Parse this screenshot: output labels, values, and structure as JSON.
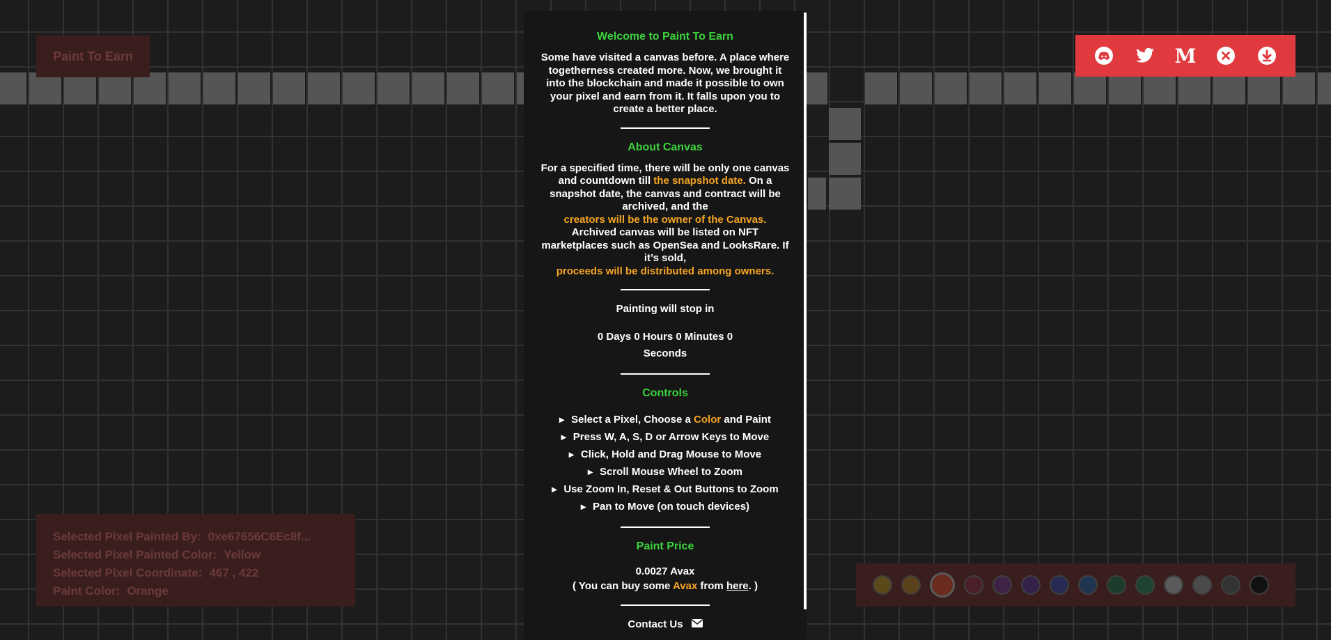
{
  "brand": {
    "title": "Paint To Earn"
  },
  "socials": [
    {
      "name": "discord-icon"
    },
    {
      "name": "twitter-icon"
    },
    {
      "name": "medium-icon",
      "glyph": "M"
    },
    {
      "name": "close-icon"
    },
    {
      "name": "download-icon"
    }
  ],
  "modal": {
    "welcome_title": "Welcome to Paint To Earn",
    "welcome_text": "Some have visited a canvas before. A place where togetherness created more. Now, we brought it into the blockchain and made it possible to own your pixel and earn from it. It falls upon you to create a better place.",
    "about_title": "About Canvas",
    "about_text_1": "For a specified time, there will be only one canvas and countdown till ",
    "about_hl_1": "the snapshot date.",
    "about_text_2": "On a snapshot date, the canvas and contract will be archived, and the",
    "about_hl_2": "creators will be the owner of the Canvas.",
    "about_text_3": "Archived canvas will be listed on NFT marketplaces such as OpenSea and LooksRare. If it’s sold,",
    "about_hl_3": "proceeds will be distributed among owners.",
    "countdown_label": "Painting will stop in",
    "countdown_value": "0 Days 0 Hours 0 Minutes 0 Seconds",
    "controls_title": "Controls",
    "controls": {
      "c1_a": "Select a Pixel, Choose a ",
      "c1_hl": "Color",
      "c1_b": " and Paint",
      "c2": "Press W, A, S, D or Arrow Keys to Move",
      "c3": "Click, Hold and Drag Mouse to Move",
      "c4": "Scroll Mouse Wheel to Zoom",
      "c5": "Use Zoom In, Reset & Out Buttons to Zoom",
      "c6": "Pan to Move (on touch devices)"
    },
    "price_title": "Paint Price",
    "price_value": "0.0027 Avax",
    "buy_a": "( You can buy some ",
    "buy_hl": "Avax",
    "buy_b": " from ",
    "buy_link": "here",
    "buy_c": ". )",
    "contact": "Contact Us"
  },
  "info": {
    "painted_by_label": "Selected Pixel Painted By:",
    "painted_by_value": "0xe67656C6Ec8f...",
    "painted_color_label": "Selected Pixel Painted Color:",
    "painted_color_value": "Yellow",
    "coordinate_label": "Selected Pixel Coordinate:",
    "coordinate_value": "467 , 422",
    "paint_color_label": "Paint Color:",
    "paint_color_value": "Orange"
  },
  "palette": [
    {
      "color": "#5a4a1a"
    },
    {
      "color": "#5c421a"
    },
    {
      "color": "#6a2a1e",
      "selected": true
    },
    {
      "color": "#4a1f2a"
    },
    {
      "color": "#3f2346"
    },
    {
      "color": "#35224a"
    },
    {
      "color": "#272a55"
    },
    {
      "color": "#1f3550"
    },
    {
      "color": "#1c3d2c"
    },
    {
      "color": "#1e4330"
    },
    {
      "color": "#5a5a5a"
    },
    {
      "color": "#4a4a4a"
    },
    {
      "color": "#333333"
    },
    {
      "color": "#111111"
    }
  ],
  "colors": {
    "accent_green": "#3cd23c",
    "highlight_orange": "#f5a524",
    "social_bar_red": "#e0393e"
  }
}
